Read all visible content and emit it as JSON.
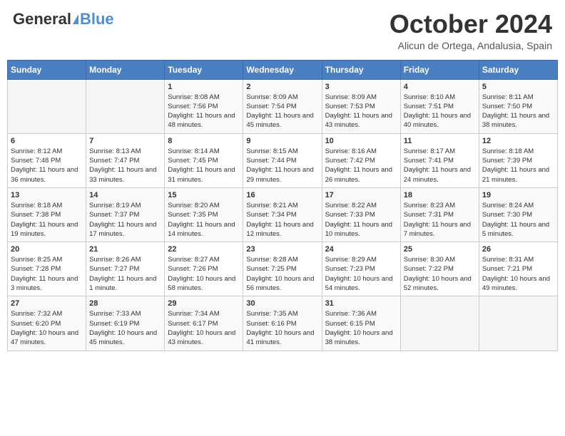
{
  "header": {
    "logo_general": "General",
    "logo_blue": "Blue",
    "month": "October 2024",
    "location": "Alicun de Ortega, Andalusia, Spain"
  },
  "days_of_week": [
    "Sunday",
    "Monday",
    "Tuesday",
    "Wednesday",
    "Thursday",
    "Friday",
    "Saturday"
  ],
  "weeks": [
    [
      {
        "day": "",
        "detail": ""
      },
      {
        "day": "",
        "detail": ""
      },
      {
        "day": "1",
        "detail": "Sunrise: 8:08 AM\nSunset: 7:56 PM\nDaylight: 11 hours and 48 minutes."
      },
      {
        "day": "2",
        "detail": "Sunrise: 8:09 AM\nSunset: 7:54 PM\nDaylight: 11 hours and 45 minutes."
      },
      {
        "day": "3",
        "detail": "Sunrise: 8:09 AM\nSunset: 7:53 PM\nDaylight: 11 hours and 43 minutes."
      },
      {
        "day": "4",
        "detail": "Sunrise: 8:10 AM\nSunset: 7:51 PM\nDaylight: 11 hours and 40 minutes."
      },
      {
        "day": "5",
        "detail": "Sunrise: 8:11 AM\nSunset: 7:50 PM\nDaylight: 11 hours and 38 minutes."
      }
    ],
    [
      {
        "day": "6",
        "detail": "Sunrise: 8:12 AM\nSunset: 7:48 PM\nDaylight: 11 hours and 36 minutes."
      },
      {
        "day": "7",
        "detail": "Sunrise: 8:13 AM\nSunset: 7:47 PM\nDaylight: 11 hours and 33 minutes."
      },
      {
        "day": "8",
        "detail": "Sunrise: 8:14 AM\nSunset: 7:45 PM\nDaylight: 11 hours and 31 minutes."
      },
      {
        "day": "9",
        "detail": "Sunrise: 8:15 AM\nSunset: 7:44 PM\nDaylight: 11 hours and 29 minutes."
      },
      {
        "day": "10",
        "detail": "Sunrise: 8:16 AM\nSunset: 7:42 PM\nDaylight: 11 hours and 26 minutes."
      },
      {
        "day": "11",
        "detail": "Sunrise: 8:17 AM\nSunset: 7:41 PM\nDaylight: 11 hours and 24 minutes."
      },
      {
        "day": "12",
        "detail": "Sunrise: 8:18 AM\nSunset: 7:39 PM\nDaylight: 11 hours and 21 minutes."
      }
    ],
    [
      {
        "day": "13",
        "detail": "Sunrise: 8:18 AM\nSunset: 7:38 PM\nDaylight: 11 hours and 19 minutes."
      },
      {
        "day": "14",
        "detail": "Sunrise: 8:19 AM\nSunset: 7:37 PM\nDaylight: 11 hours and 17 minutes."
      },
      {
        "day": "15",
        "detail": "Sunrise: 8:20 AM\nSunset: 7:35 PM\nDaylight: 11 hours and 14 minutes."
      },
      {
        "day": "16",
        "detail": "Sunrise: 8:21 AM\nSunset: 7:34 PM\nDaylight: 11 hours and 12 minutes."
      },
      {
        "day": "17",
        "detail": "Sunrise: 8:22 AM\nSunset: 7:33 PM\nDaylight: 11 hours and 10 minutes."
      },
      {
        "day": "18",
        "detail": "Sunrise: 8:23 AM\nSunset: 7:31 PM\nDaylight: 11 hours and 7 minutes."
      },
      {
        "day": "19",
        "detail": "Sunrise: 8:24 AM\nSunset: 7:30 PM\nDaylight: 11 hours and 5 minutes."
      }
    ],
    [
      {
        "day": "20",
        "detail": "Sunrise: 8:25 AM\nSunset: 7:28 PM\nDaylight: 11 hours and 3 minutes."
      },
      {
        "day": "21",
        "detail": "Sunrise: 8:26 AM\nSunset: 7:27 PM\nDaylight: 11 hours and 1 minute."
      },
      {
        "day": "22",
        "detail": "Sunrise: 8:27 AM\nSunset: 7:26 PM\nDaylight: 10 hours and 58 minutes."
      },
      {
        "day": "23",
        "detail": "Sunrise: 8:28 AM\nSunset: 7:25 PM\nDaylight: 10 hours and 56 minutes."
      },
      {
        "day": "24",
        "detail": "Sunrise: 8:29 AM\nSunset: 7:23 PM\nDaylight: 10 hours and 54 minutes."
      },
      {
        "day": "25",
        "detail": "Sunrise: 8:30 AM\nSunset: 7:22 PM\nDaylight: 10 hours and 52 minutes."
      },
      {
        "day": "26",
        "detail": "Sunrise: 8:31 AM\nSunset: 7:21 PM\nDaylight: 10 hours and 49 minutes."
      }
    ],
    [
      {
        "day": "27",
        "detail": "Sunrise: 7:32 AM\nSunset: 6:20 PM\nDaylight: 10 hours and 47 minutes."
      },
      {
        "day": "28",
        "detail": "Sunrise: 7:33 AM\nSunset: 6:19 PM\nDaylight: 10 hours and 45 minutes."
      },
      {
        "day": "29",
        "detail": "Sunrise: 7:34 AM\nSunset: 6:17 PM\nDaylight: 10 hours and 43 minutes."
      },
      {
        "day": "30",
        "detail": "Sunrise: 7:35 AM\nSunset: 6:16 PM\nDaylight: 10 hours and 41 minutes."
      },
      {
        "day": "31",
        "detail": "Sunrise: 7:36 AM\nSunset: 6:15 PM\nDaylight: 10 hours and 38 minutes."
      },
      {
        "day": "",
        "detail": ""
      },
      {
        "day": "",
        "detail": ""
      }
    ]
  ]
}
